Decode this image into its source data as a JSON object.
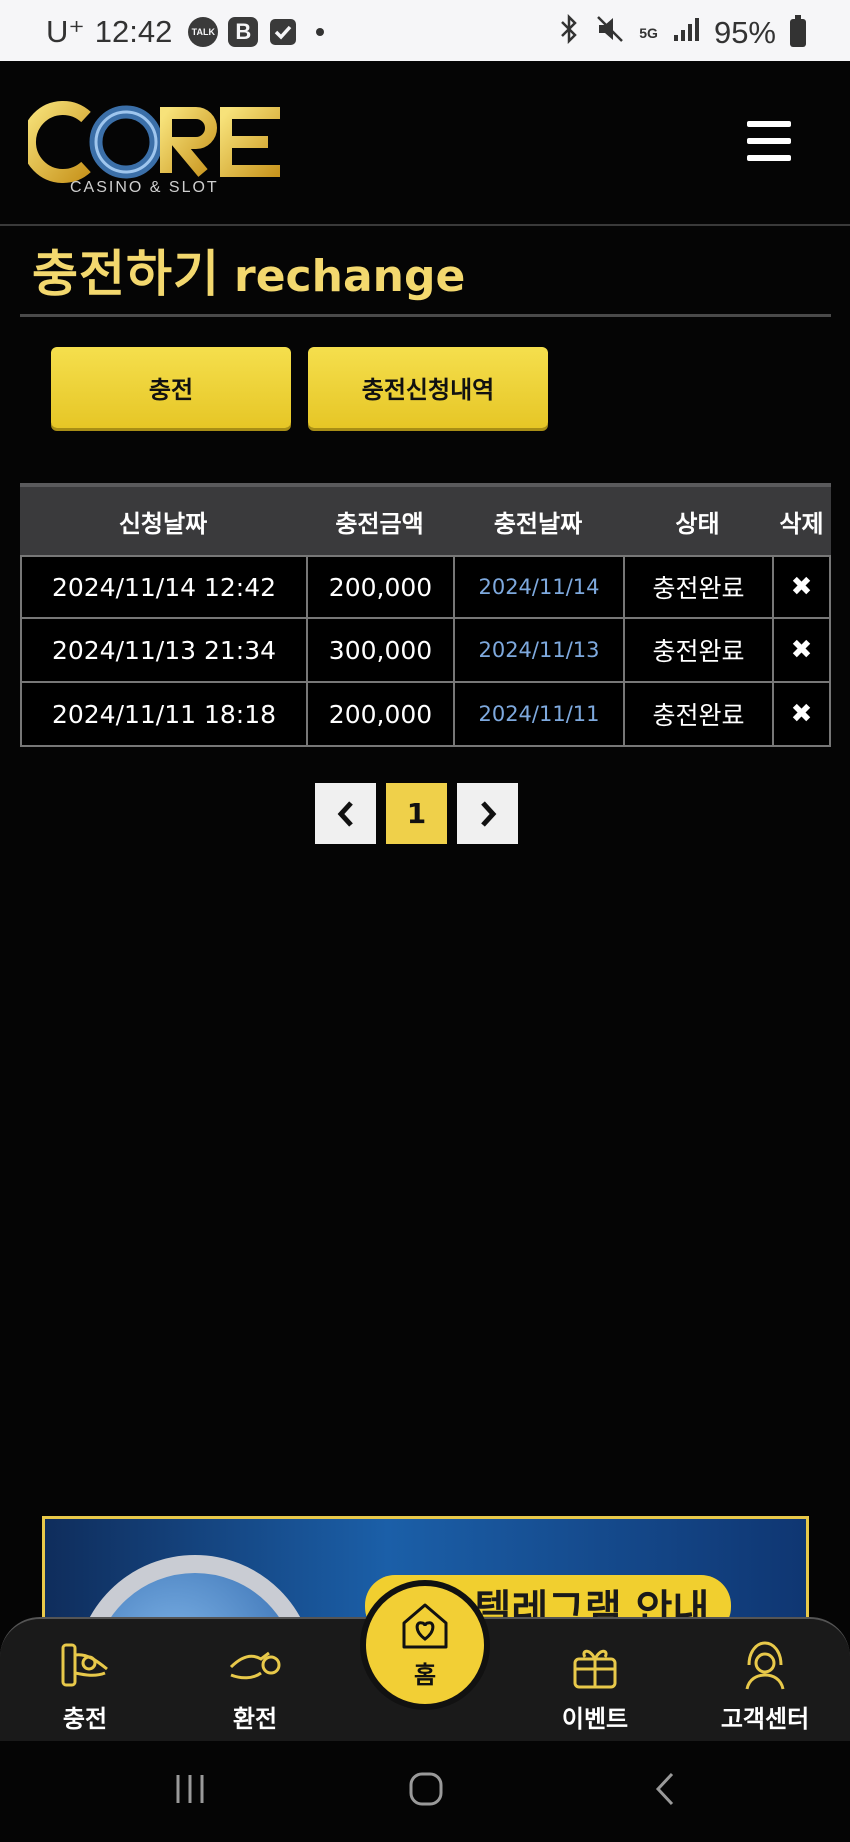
{
  "status_bar": {
    "carrier": "U⁺",
    "time": "12:42",
    "talk_label": "TALK",
    "b_label": "B",
    "network": "5G",
    "battery": "95%"
  },
  "header": {
    "logo_text": "CORE",
    "logo_subtitle": "CASINO & SLOT"
  },
  "page": {
    "title_ko": "충전하기",
    "title_en": "rechange"
  },
  "tabs": [
    {
      "label": "충전"
    },
    {
      "label": "충전신청내역"
    }
  ],
  "table": {
    "headers": [
      "신청날짜",
      "충전금액",
      "충전날짜",
      "상태",
      "삭제"
    ],
    "rows": [
      {
        "request_date": "2024/11/14 12:42",
        "amount": "200,000",
        "charge_date": "2024/11/14",
        "status": "충전완료",
        "delete": "✖"
      },
      {
        "request_date": "2024/11/13 21:34",
        "amount": "300,000",
        "charge_date": "2024/11/13",
        "status": "충전완료",
        "delete": "✖"
      },
      {
        "request_date": "2024/11/11 18:18",
        "amount": "200,000",
        "charge_date": "2024/11/11",
        "status": "충전완료",
        "delete": "✖"
      }
    ]
  },
  "pagination": {
    "prev": "‹",
    "current": "1",
    "next": "›"
  },
  "banner": {
    "text": "공식 텔레그램 안내"
  },
  "bottom_nav": [
    {
      "label": "충전",
      "icon": "deposit-icon"
    },
    {
      "label": "환전",
      "icon": "withdraw-icon"
    },
    {
      "label": "홈",
      "icon": "home-heart-icon"
    },
    {
      "label": "이벤트",
      "icon": "gift-icon"
    },
    {
      "label": "고객센터",
      "icon": "support-icon"
    }
  ],
  "colors": {
    "accent": "#f2cf35",
    "title": "#f3d86e",
    "date_link": "#7ea9de",
    "background": "#050505"
  }
}
